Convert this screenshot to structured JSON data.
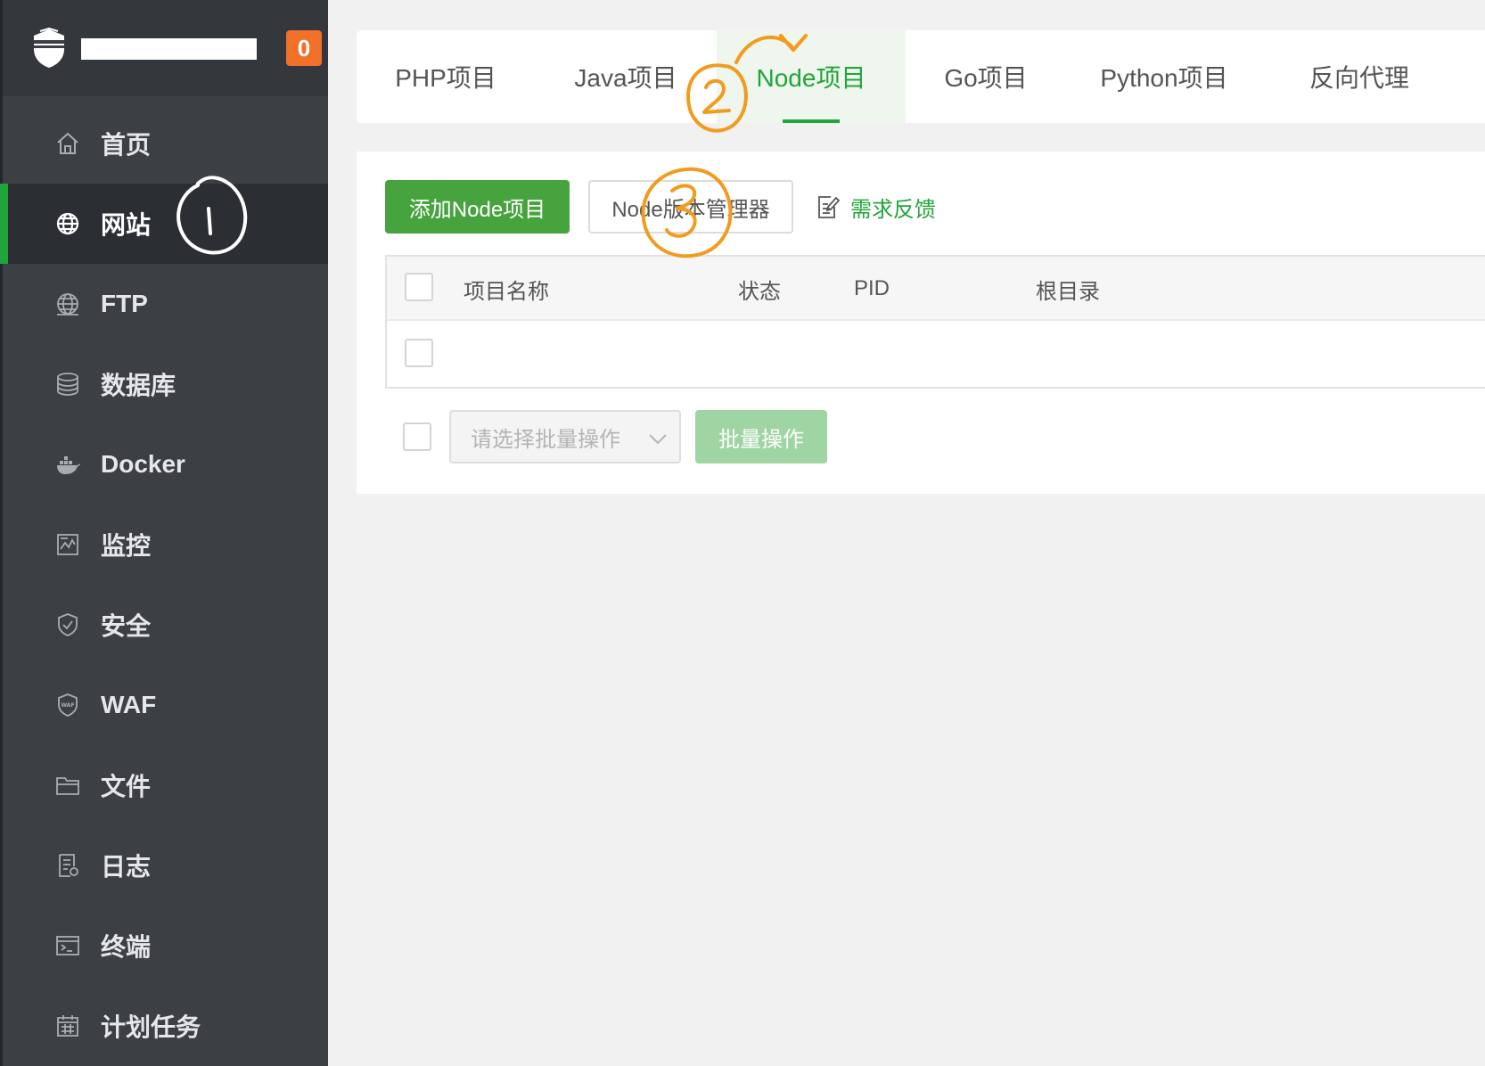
{
  "brand": {
    "badge_count": "0",
    "logo_icon": "shield-logo-icon"
  },
  "sidebar": {
    "items": [
      {
        "label": "首页",
        "icon": "home-icon"
      },
      {
        "label": "网站",
        "icon": "globe-icon"
      },
      {
        "label": "FTP",
        "icon": "ftp-globe-icon"
      },
      {
        "label": "数据库",
        "icon": "database-icon"
      },
      {
        "label": "Docker",
        "icon": "docker-icon"
      },
      {
        "label": "监控",
        "icon": "monitor-icon"
      },
      {
        "label": "安全",
        "icon": "shield-check-icon"
      },
      {
        "label": "WAF",
        "icon": "waf-shield-icon"
      },
      {
        "label": "文件",
        "icon": "folder-icon"
      },
      {
        "label": "日志",
        "icon": "log-icon"
      },
      {
        "label": "终端",
        "icon": "terminal-icon"
      },
      {
        "label": "计划任务",
        "icon": "calendar-icon"
      }
    ],
    "active_index": 1
  },
  "tabs": [
    {
      "label": "PHP项目"
    },
    {
      "label": "Java项目"
    },
    {
      "label": "Node项目"
    },
    {
      "label": "Go项目"
    },
    {
      "label": "Python项目"
    },
    {
      "label": "反向代理"
    }
  ],
  "active_tab_index": 2,
  "toolbar": {
    "add_label": "添加Node项目",
    "version_manager_label": "Node版本管理器",
    "feedback_label": "需求反馈",
    "feedback_icon": "edit-note-icon"
  },
  "table": {
    "columns": [
      "项目名称",
      "状态",
      "PID",
      "根目录"
    ]
  },
  "batch": {
    "select_placeholder": "请选择批量操作",
    "button_label": "批量操作"
  },
  "annotations": [
    "1",
    "2",
    "3"
  ],
  "colors": {
    "accent": "#20a53a",
    "sidebar_bg": "#3c4045",
    "badge": "#f2712a",
    "annotation_orange": "#f29b1d"
  }
}
